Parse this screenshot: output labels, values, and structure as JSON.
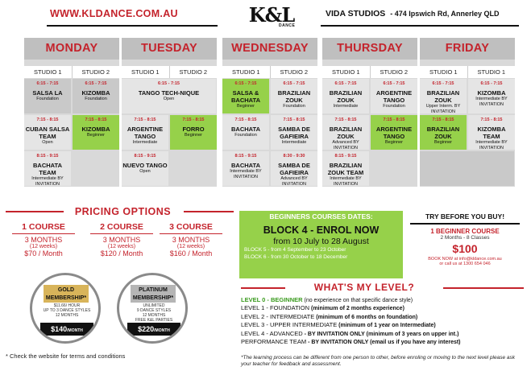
{
  "header": {
    "url": "WWW.KLDANCE.COM.AU",
    "logo_text": "K&L",
    "logo_sub": "DANCE",
    "venue": "VIDA STUDIOS",
    "address": "- 474 Ipswich Rd, Annerley QLD"
  },
  "schedule": [
    {
      "day": "MONDAY",
      "studios": [
        "STUDIO 1",
        "STUDIO 2"
      ],
      "cells": [
        {
          "time": "6:15 - 7:15",
          "name": "SALSA LA",
          "level": "Foundation"
        },
        {
          "time": "6:15 - 7:15",
          "name": "KIZOMBA",
          "level": "Foundation"
        },
        {
          "time": "7:15 - 8:15",
          "name": "CUBAN SALSA TEAM",
          "level": "Open"
        },
        {
          "time": "7:15 - 8:15",
          "name": "KIZOMBA",
          "level": "Beginner"
        },
        {
          "time": "8:15 - 9:15",
          "name": "BACHATA TEAM",
          "level": "Intermediate BY INVITATION"
        }
      ]
    },
    {
      "day": "TUESDAY",
      "studios": [
        "STUDIO 1",
        "STUDIO 2"
      ],
      "cells": [
        {
          "time": "6:15 - 7:15",
          "name": "TANGO TECH-NIQUE",
          "level": "Open"
        },
        {
          "time": "7:15 - 8:15",
          "name": "ARGENTINE TANGO",
          "level": "Intermediate"
        },
        {
          "time": "7:15 - 8:15",
          "name": "FORRO",
          "level": "Beginner"
        },
        {
          "time": "8:15 - 9:15",
          "name": "NUEVO TANGO",
          "level": "Open"
        }
      ]
    },
    {
      "day": "WEDNESDAY",
      "studios": [
        "STUDIO 1",
        "STUDIO 2"
      ],
      "cells": [
        {
          "time": "6:15 - 7:15",
          "name": "SALSA & BACHATA",
          "level": "Beginner"
        },
        {
          "time": "6:15 - 7:15",
          "name": "BRAZILIAN ZOUK",
          "level": "Foundation"
        },
        {
          "time": "7:15 - 8:15",
          "name": "BACHATA",
          "level": "Foundation"
        },
        {
          "time": "7:15 - 8:15",
          "name": "SAMBA DE GAFIEIRA",
          "level": "Intermediate"
        },
        {
          "time": "8:15 - 9:15",
          "name": "BACHATA",
          "level": "Intermediate BY INVITATION"
        },
        {
          "time": "8:30 - 9:30",
          "name": "SAMBA DE GAFIEIRA",
          "level": "Advanced BY INVITATION"
        }
      ]
    },
    {
      "day": "THURSDAY",
      "studios": [
        "STUDIO 1",
        "STUDIO 2"
      ],
      "cells": [
        {
          "time": "6:15 - 7:15",
          "name": "BRAZILIAN ZOUK",
          "level": "Intermediate"
        },
        {
          "time": "6:15 - 7:15",
          "name": "ARGENTINE TANGO",
          "level": "Foundation"
        },
        {
          "time": "7:15 - 8:15",
          "name": "BRAZILIAN ZOUK",
          "level": "Advanced BY INVITATION"
        },
        {
          "time": "7:15 - 8:15",
          "name": "ARGENTINE TANGO",
          "level": "Beginner"
        },
        {
          "time": "8:15 - 9:15",
          "name": "BRAZILIAN ZOUK TEAM",
          "level": "Intermediate BY INVITATION"
        }
      ]
    },
    {
      "day": "FRIDAY",
      "studios": [
        "STUDIO 1",
        "STUDIO 1"
      ],
      "cells": [
        {
          "time": "6:15 - 7:15",
          "name": "BRAZILIAN ZOUK",
          "level": "Upper Interm. BY INVITATION"
        },
        {
          "time": "6:15 - 7:15",
          "name": "KIZOMBA",
          "level": "Intermediate BY INVITATION"
        },
        {
          "time": "7:15 - 8:15",
          "name": "BRAZILIAN ZOUK",
          "level": "Beginner"
        },
        {
          "time": "7:15 - 8:15",
          "name": "KIZOMBA TEAM",
          "level": "Intermediate BY INVITATION"
        }
      ]
    }
  ],
  "pricing": {
    "title": "PRICING OPTIONS",
    "courses": [
      {
        "head": "1 COURSE",
        "months": "3 MONTHS",
        "weeks": "(12 weeks)",
        "price": "$70 / Month"
      },
      {
        "head": "2 COURSE",
        "months": "3 MONTHS",
        "weeks": "(12 weeks)",
        "price": "$120 / Month"
      },
      {
        "head": "3 COURSE",
        "months": "3 MONTHS",
        "weeks": "(12 weeks)",
        "price": "$160 / Month"
      }
    ]
  },
  "memberships": [
    {
      "title": "GOLD",
      "sub": "MEMBERSHIP*",
      "lines": [
        "$11.66/ HOUR",
        "UP TO 3 DANCE STYLES",
        "12 MONTHS"
      ],
      "price": "$140",
      "per": "/MONTH"
    },
    {
      "title": "PLATINUM",
      "sub": "MEMBERSHIP*",
      "lines": [
        "UNLIMITED",
        "9 DANCE STYLES",
        "12 MONTHS",
        "FREE K&L PARTIES"
      ],
      "price": "$220",
      "per": "/MONTH"
    }
  ],
  "terms": "* Check the website for terms and conditions",
  "beginners": {
    "title": "BEGINNERS COURSES DATES:",
    "block": "BLOCK 4 - ENROL NOW",
    "dates": "from 10 July to 28 August",
    "block5": "BLOCK 5 - from 4 September to 23 October",
    "block6": "BLOCK 6 - from 30 October to 18 December"
  },
  "trial": {
    "title": "TRY BEFORE YOU BUY!",
    "course": "1 BEGINNER COURSE",
    "detail": "2 Months - 8 Classes",
    "price": "$100",
    "book": "BOOK NOW at info@kldance.com.au",
    "call": "or call us at 1300 654 046"
  },
  "levels": {
    "title": "WHAT'S MY LEVEL?",
    "items": [
      {
        "name": "LEVEL 0 - BEGINNER",
        "desc": "(no experience on that specific dance style)"
      },
      {
        "name": "LEVEL 1 - FOUNDATION",
        "desc": "(minimum of 2 months experience)"
      },
      {
        "name": "LEVEL 2 - INTERMEDIATE",
        "desc": "(minimum of 6 months on foundation)"
      },
      {
        "name": "LEVEL 3 - UPPER INTERMEDIATE",
        "desc": "(minimum of 1 year on Intermediate)"
      },
      {
        "name": "LEVEL 4 - ADVANCED",
        "desc": "- BY INVITATION ONLY (minimum of 3 years on upper int.)"
      },
      {
        "name": "PERFORMANCE TEAM",
        "desc": "- BY INVITATION ONLY (email us if you have any interest)"
      }
    ],
    "note": "*The learning process can be different from one person to other, before enroling or moving to the next level please ask your teacher for feedback and assessment."
  },
  "colors": {
    "accent": "#c4232c",
    "green": "#96d14a",
    "grey": "#d9d9d9"
  }
}
